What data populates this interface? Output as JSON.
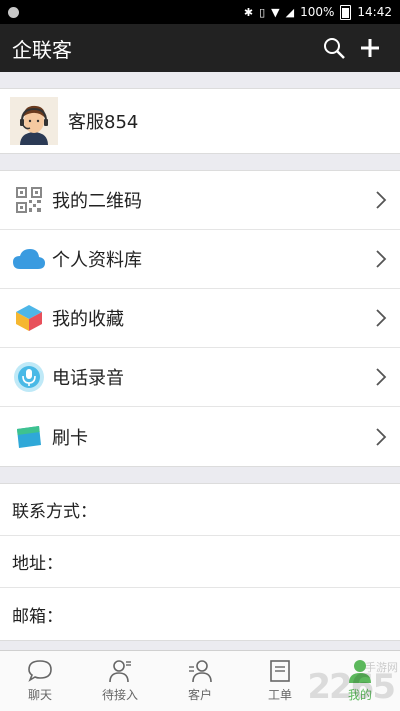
{
  "status": {
    "battery": "100%",
    "time": "14:42"
  },
  "header": {
    "title": "企联客"
  },
  "profile": {
    "name": "客服854"
  },
  "menu": [
    {
      "label": "我的二维码",
      "icon": "qr-code-icon"
    },
    {
      "label": "个人资料库",
      "icon": "cloud-icon"
    },
    {
      "label": "我的收藏",
      "icon": "cube-icon"
    },
    {
      "label": "电话录音",
      "icon": "microphone-icon"
    },
    {
      "label": "刷卡",
      "icon": "card-icon"
    }
  ],
  "info": [
    {
      "label": "联系方式："
    },
    {
      "label": "地址："
    },
    {
      "label": "邮箱："
    }
  ],
  "tabs": [
    {
      "label": "聊天",
      "icon": "chat-icon"
    },
    {
      "label": "待接入",
      "icon": "person-waiting-icon"
    },
    {
      "label": "客户",
      "icon": "customers-icon"
    },
    {
      "label": "工单",
      "icon": "ticket-icon"
    },
    {
      "label": "我的",
      "icon": "me-icon",
      "active": true
    }
  ],
  "watermark": {
    "text": "2265",
    "sub": "手游网"
  },
  "colors": {
    "appbar": "#222222",
    "accent": "#5cb85c",
    "background": "#ebebf0"
  }
}
